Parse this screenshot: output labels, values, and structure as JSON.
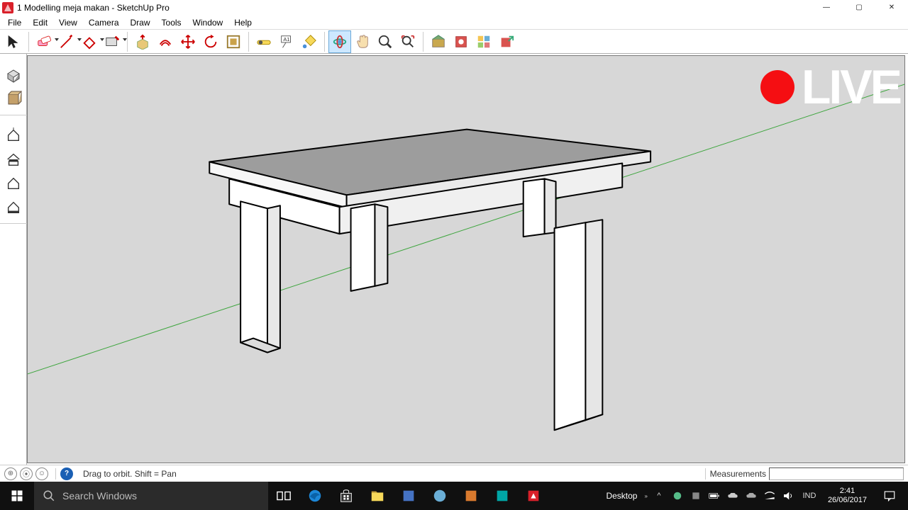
{
  "window": {
    "title": "1 Modelling meja makan - SketchUp Pro",
    "buttons": {
      "min": "—",
      "max": "▢",
      "close": "✕"
    }
  },
  "menu": [
    "File",
    "Edit",
    "View",
    "Camera",
    "Draw",
    "Tools",
    "Window",
    "Help"
  ],
  "status": {
    "hint": "Drag to orbit.  Shift = Pan",
    "measurements_label": "Measurements",
    "measurements_value": ""
  },
  "live_overlay": "LIVE",
  "taskbar": {
    "search_placeholder": "Search Windows",
    "desktop_label": "Desktop",
    "lang": "IND",
    "time": "2:41",
    "date": "26/06/2017"
  }
}
